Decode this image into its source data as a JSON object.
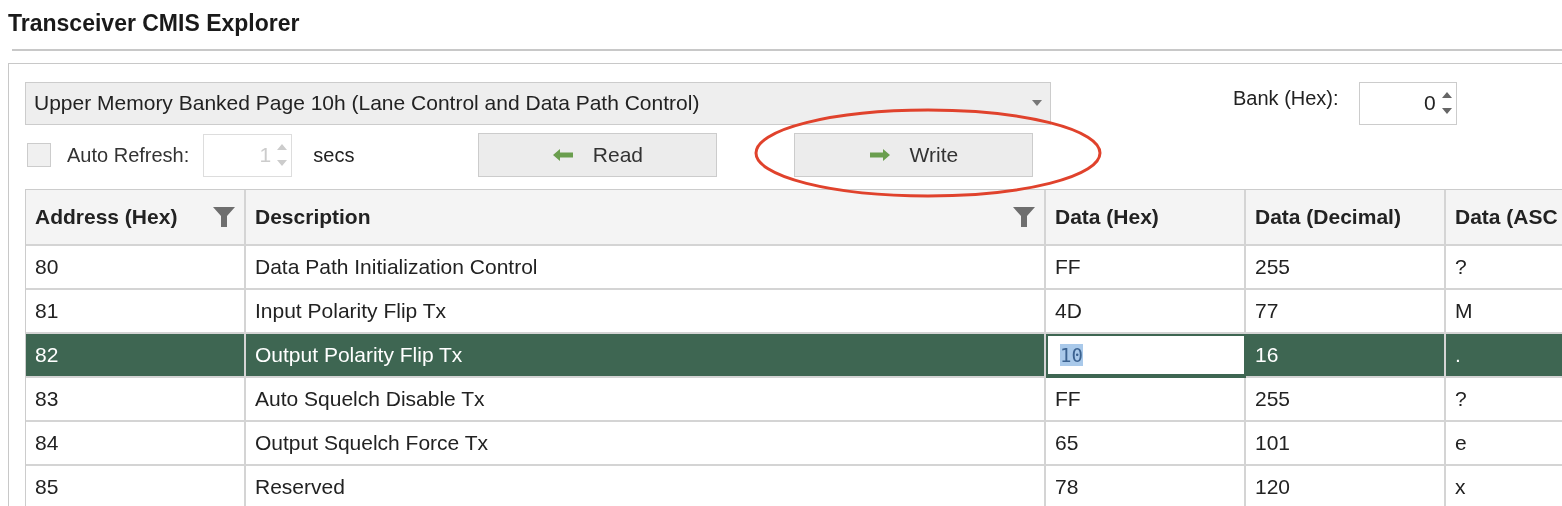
{
  "window": {
    "title": "Transceiver CMIS Explorer"
  },
  "page_select": {
    "value": "Upper Memory Banked Page 10h (Lane Control and Data Path Control)"
  },
  "bank": {
    "label": "Bank (Hex):",
    "value": "0"
  },
  "auto_refresh": {
    "label": "Auto Refresh:",
    "checked": false,
    "value": "1",
    "disabled": true,
    "unit": "secs"
  },
  "buttons": [
    {
      "kind": "read",
      "label": "Read"
    },
    {
      "kind": "write",
      "label": "Write"
    }
  ],
  "annotations": [
    {
      "kind": "ellipse"
    }
  ],
  "table": {
    "columns": [
      {
        "label": "Address (Hex)",
        "filter": true
      },
      {
        "label": "Description",
        "filter": true
      },
      {
        "label": "Data (Hex)",
        "filter": false
      },
      {
        "label": "Data (Decimal)",
        "filter": false
      },
      {
        "label": "Data (ASC",
        "filter": false
      }
    ],
    "rows": [
      {
        "address": "80",
        "description": "Data Path Initialization Control",
        "hex": "FF",
        "decimal": "255",
        "ascii": "?",
        "selected": false,
        "editing": false
      },
      {
        "address": "81",
        "description": "Input Polarity Flip Tx",
        "hex": "4D",
        "decimal": "77",
        "ascii": "M",
        "selected": false,
        "editing": false
      },
      {
        "address": "82",
        "description": "Output Polarity Flip Tx",
        "hex": "10",
        "decimal": "16",
        "ascii": ".",
        "selected": true,
        "editing": true
      },
      {
        "address": "83",
        "description": "Auto Squelch Disable Tx",
        "hex": "FF",
        "decimal": "255",
        "ascii": "?",
        "selected": false,
        "editing": false
      },
      {
        "address": "84",
        "description": "Output Squelch Force Tx",
        "hex": "65",
        "decimal": "101",
        "ascii": "e",
        "selected": false,
        "editing": false
      },
      {
        "address": "85",
        "description": "Reserved",
        "hex": "78",
        "decimal": "120",
        "ascii": "x",
        "selected": false,
        "editing": false
      }
    ]
  }
}
